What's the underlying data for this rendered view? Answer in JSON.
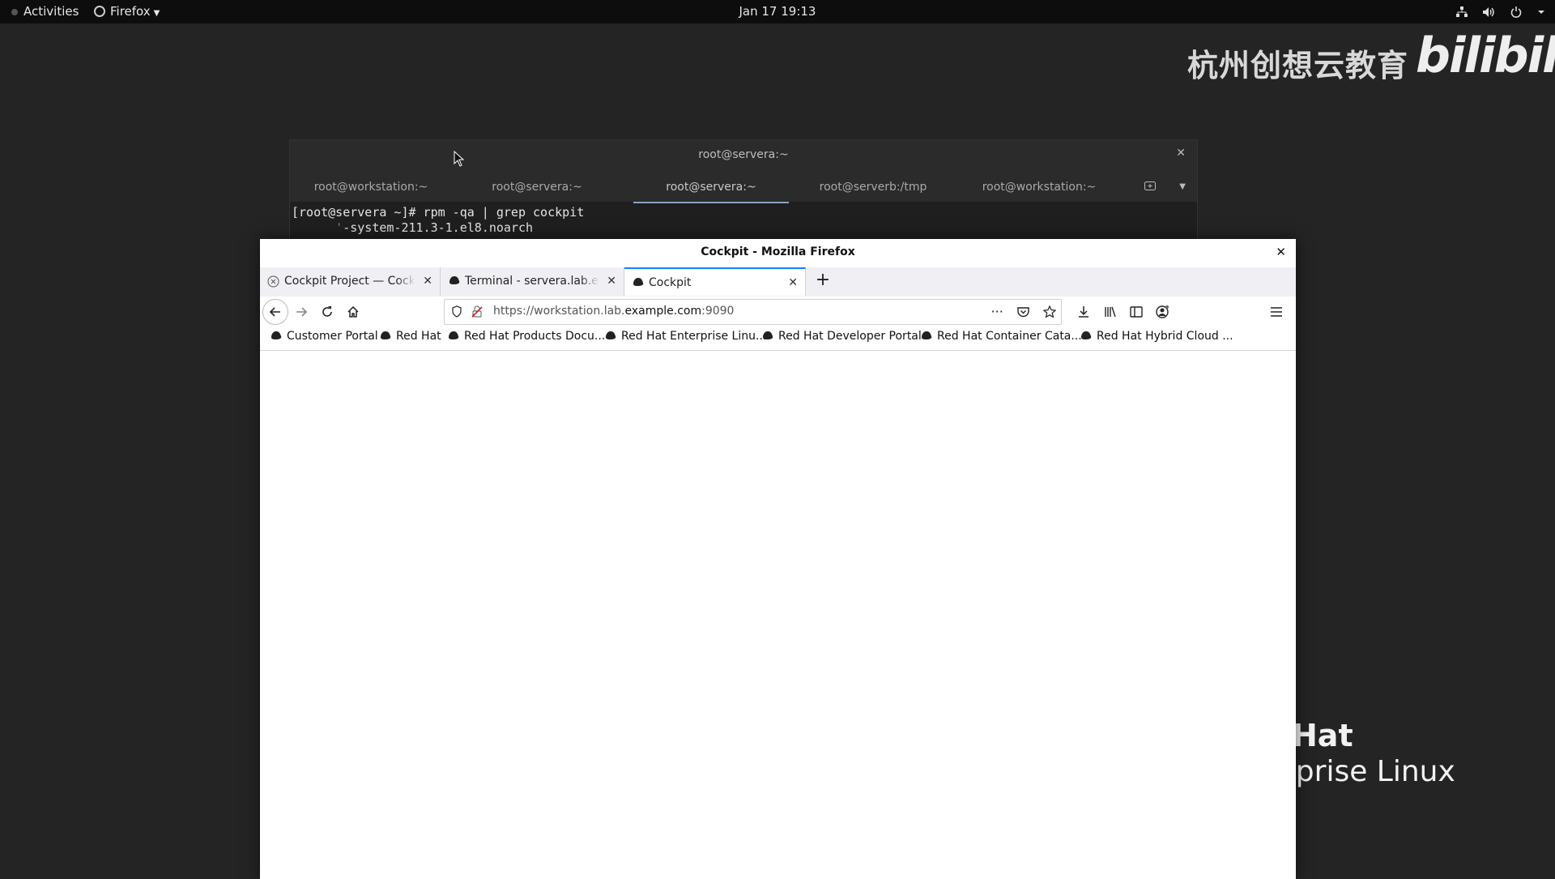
{
  "topbar": {
    "activities": "Activities",
    "app_menu": "Firefox",
    "clock": "Jan 17  19:13"
  },
  "watermark": {
    "text_cn": "杭州创想云教育",
    "text_logo": "bilibili"
  },
  "desktop_logo": {
    "line1": "Hat",
    "line2": "rprise Linux"
  },
  "terminal": {
    "title": "root@servera:~",
    "tabs": [
      "root@workstation:~",
      "root@servera:~",
      "root@servera:~",
      "root@serverb:/tmp",
      "root@workstation:~"
    ],
    "active_tab_index": 2,
    "lines": [
      "[root@servera ~]# rpm -qa | grep cockpit",
      "-system-211.3-1.el8.noarch"
    ]
  },
  "firefox": {
    "window_title": "Cockpit - Mozilla Firefox",
    "tabs": [
      {
        "label": "Cockpit Project — Cockpit",
        "icon": "cockpit-icon"
      },
      {
        "label": "Terminal - servera.lab.example.com",
        "icon": "redhat-icon"
      },
      {
        "label": "Cockpit",
        "icon": "redhat-icon"
      }
    ],
    "active_tab_index": 2,
    "url": {
      "prefix": "https://workstation.lab.",
      "host": "example.com",
      "suffix": ":9090"
    },
    "bookmarks": [
      "Customer Portal",
      "Red Hat",
      "Red Hat Products Docu...",
      "Red Hat Enterprise Linu...",
      "Red Hat Developer Portal",
      "Red Hat Container Cata...",
      "Red Hat Hybrid Cloud ..."
    ]
  },
  "colors": {
    "desktop_bg": "#242424",
    "topbar_bg": "#0d0d0d",
    "active_tab_accent": "#0a84ff"
  }
}
